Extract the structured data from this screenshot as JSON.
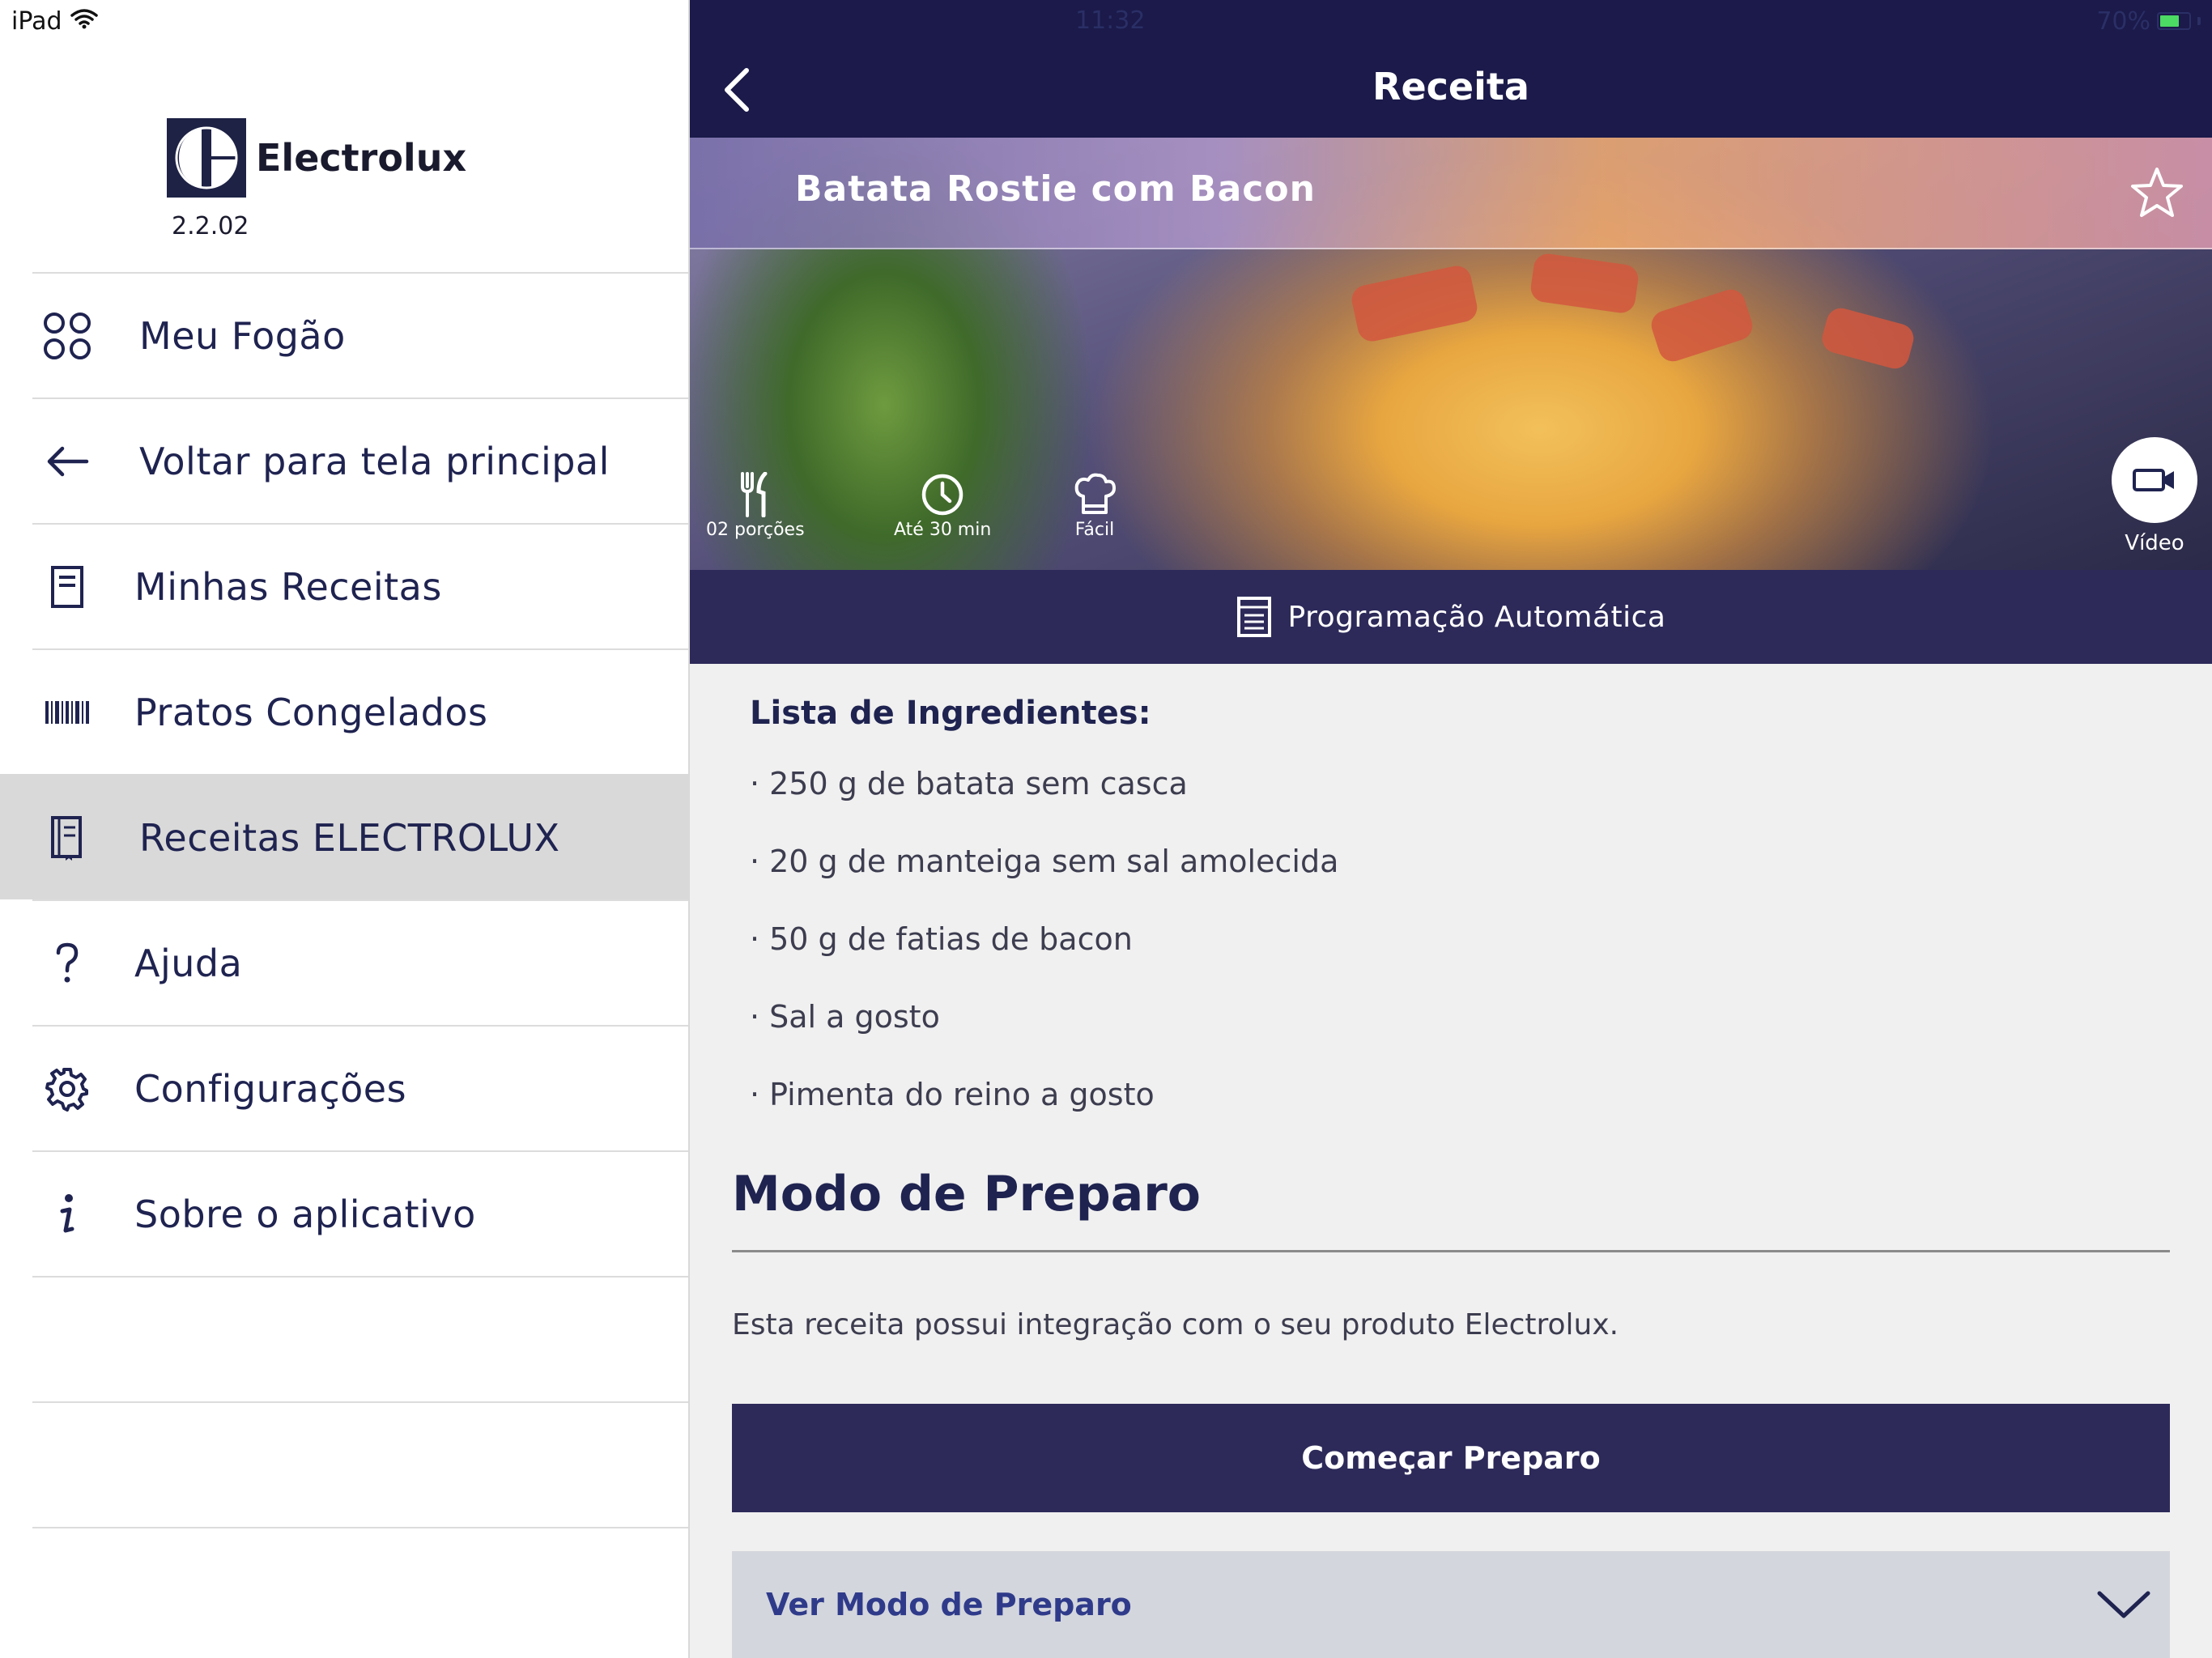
{
  "status": {
    "device": "iPad",
    "time": "11:32",
    "battery": "70%",
    "battery_level": 0.7
  },
  "sidebar": {
    "brand": "Electrolux",
    "version": "2.2.02",
    "items": [
      {
        "label": "Meu Fogão",
        "icon": "grid-circles-icon"
      },
      {
        "label": "Voltar para tela principal",
        "icon": "arrow-left-icon"
      },
      {
        "label": "Minhas Receitas",
        "icon": "document-icon"
      },
      {
        "label": "Pratos Congelados",
        "icon": "barcode-icon"
      },
      {
        "label": "Receitas ELECTROLUX",
        "icon": "book-icon",
        "active": true
      },
      {
        "label": "Ajuda",
        "icon": "question-icon"
      },
      {
        "label": "Configurações",
        "icon": "gear-icon"
      },
      {
        "label": "Sobre o aplicativo",
        "icon": "info-icon"
      }
    ]
  },
  "header": {
    "title": "Receita"
  },
  "recipe": {
    "title": "Batata Rostie com Bacon",
    "portions": "02 porções",
    "time": "Até 30 min",
    "difficulty": "Fácil",
    "video_label": "Vídeo"
  },
  "auto_program": {
    "label": "Programação Automática"
  },
  "ingredients": {
    "title": "Lista de Ingredientes:",
    "items": [
      "250 g de batata sem casca",
      "20 g de manteiga sem sal amolecida",
      "50 g de fatias de bacon",
      "Sal a gosto",
      "Pimenta do reino a gosto"
    ]
  },
  "preparation": {
    "title": "Modo de Preparo",
    "description": "Esta receita possui integração com o seu produto Electrolux.",
    "start_button": "Começar Preparo",
    "view_label": "Ver Modo de Preparo"
  },
  "colors": {
    "navy": "#1b1a4a",
    "bar": "#2d2a5a",
    "accent_text": "#2f3b8a",
    "active_row": "#d9d9d9"
  }
}
